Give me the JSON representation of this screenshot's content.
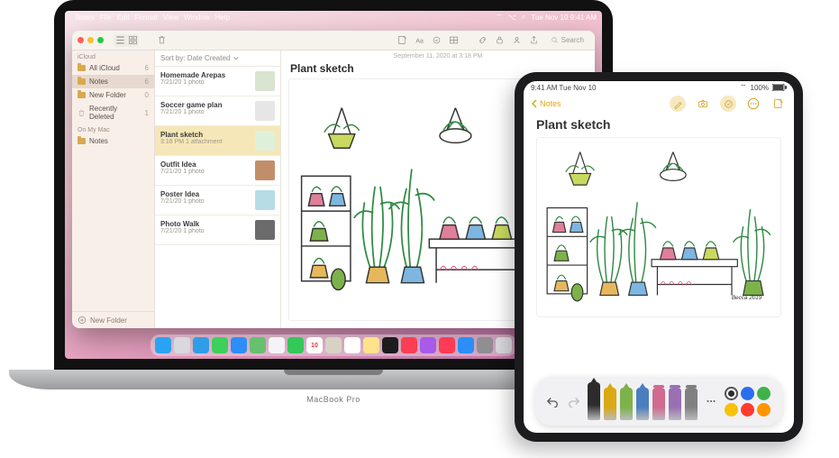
{
  "mac": {
    "brand": "MacBook Pro",
    "menubar": {
      "app": "Notes",
      "items": [
        "File",
        "Edit",
        "Format",
        "View",
        "Window",
        "Help"
      ],
      "clock": "Tue Nov 10  9:41 AM"
    },
    "dock": [
      {
        "name": "finder",
        "bg": "#2aa3f4"
      },
      {
        "name": "launchpad",
        "bg": "#d8d8de"
      },
      {
        "name": "safari",
        "bg": "#2f9de8"
      },
      {
        "name": "messages",
        "bg": "#3fcf5b"
      },
      {
        "name": "mail",
        "bg": "#2e8ef7"
      },
      {
        "name": "maps",
        "bg": "#66c06e"
      },
      {
        "name": "photos",
        "bg": "#f4f4f6"
      },
      {
        "name": "facetime",
        "bg": "#34c759"
      },
      {
        "name": "calendar",
        "bg": "#ffffff"
      },
      {
        "name": "contacts",
        "bg": "#d8d2c4"
      },
      {
        "name": "reminders",
        "bg": "#ffffff"
      },
      {
        "name": "notes",
        "bg": "#ffe28a"
      },
      {
        "name": "tv",
        "bg": "#1c1c1e"
      },
      {
        "name": "music",
        "bg": "#fa3e54"
      },
      {
        "name": "podcasts",
        "bg": "#a85ae8"
      },
      {
        "name": "news",
        "bg": "#ff3b55"
      },
      {
        "name": "appstore",
        "bg": "#2c8ef6"
      },
      {
        "name": "preferences",
        "bg": "#8e8e93"
      },
      {
        "name": "trash",
        "bg": "#d8d8de"
      }
    ]
  },
  "notes_window": {
    "sort_label": "Sort by: Date Created",
    "search_placeholder": "Search",
    "sidebar": {
      "section1": "iCloud",
      "section2": "On My Mac",
      "items1": [
        {
          "label": "All iCloud",
          "count": "6"
        },
        {
          "label": "Notes",
          "count": "6",
          "selected": true
        },
        {
          "label": "New Folder",
          "count": "0"
        },
        {
          "label": "Recently Deleted",
          "count": "1",
          "trash": true
        }
      ],
      "items2": [
        {
          "label": "Notes",
          "count": ""
        }
      ],
      "new_folder": "New Folder"
    },
    "notes": [
      {
        "title": "Homemade Arepas",
        "sub": "7/21/20   1 photo",
        "thumb": "#d9e4d1"
      },
      {
        "title": "Soccer game plan",
        "sub": "7/21/20   1 photo",
        "thumb": "#e6e6e6"
      },
      {
        "title": "Plant sketch",
        "sub": "3:18 PM   1 attachment",
        "thumb": "#dff0da",
        "selected": true
      },
      {
        "title": "Outfit Idea",
        "sub": "7/21/20   1 photo",
        "thumb": "#c28e6a"
      },
      {
        "title": "Poster Idea",
        "sub": "7/21/20   1 photo",
        "thumb": "#b8dbe8"
      },
      {
        "title": "Photo Walk",
        "sub": "7/21/20   1 photo",
        "thumb": "#6b6b6b"
      }
    ],
    "detail": {
      "meta": "September 11, 2020 at 3:18 PM",
      "title": "Plant sketch"
    }
  },
  "ipad": {
    "status_time": "9:41 AM  Tue Nov 10",
    "status_battery": "100%",
    "back_label": "Notes",
    "title": "Plant sketch",
    "markup": {
      "tools": [
        {
          "name": "pen",
          "color": "#2c2c2c"
        },
        {
          "name": "marker",
          "color": "#d9a813"
        },
        {
          "name": "highlighter",
          "color": "#7db24a"
        },
        {
          "name": "pencil",
          "color": "#4a7fbf"
        },
        {
          "name": "eraser",
          "color": "#d06a8f"
        },
        {
          "name": "lasso",
          "color": "#9a6fb4"
        },
        {
          "name": "ruler",
          "color": "#808080"
        }
      ],
      "swatches": [
        "#2c2c2c",
        "#2a6ef0",
        "#3fb24a",
        "#f4c20d",
        "#ff3b30",
        "#ff9500"
      ]
    }
  }
}
